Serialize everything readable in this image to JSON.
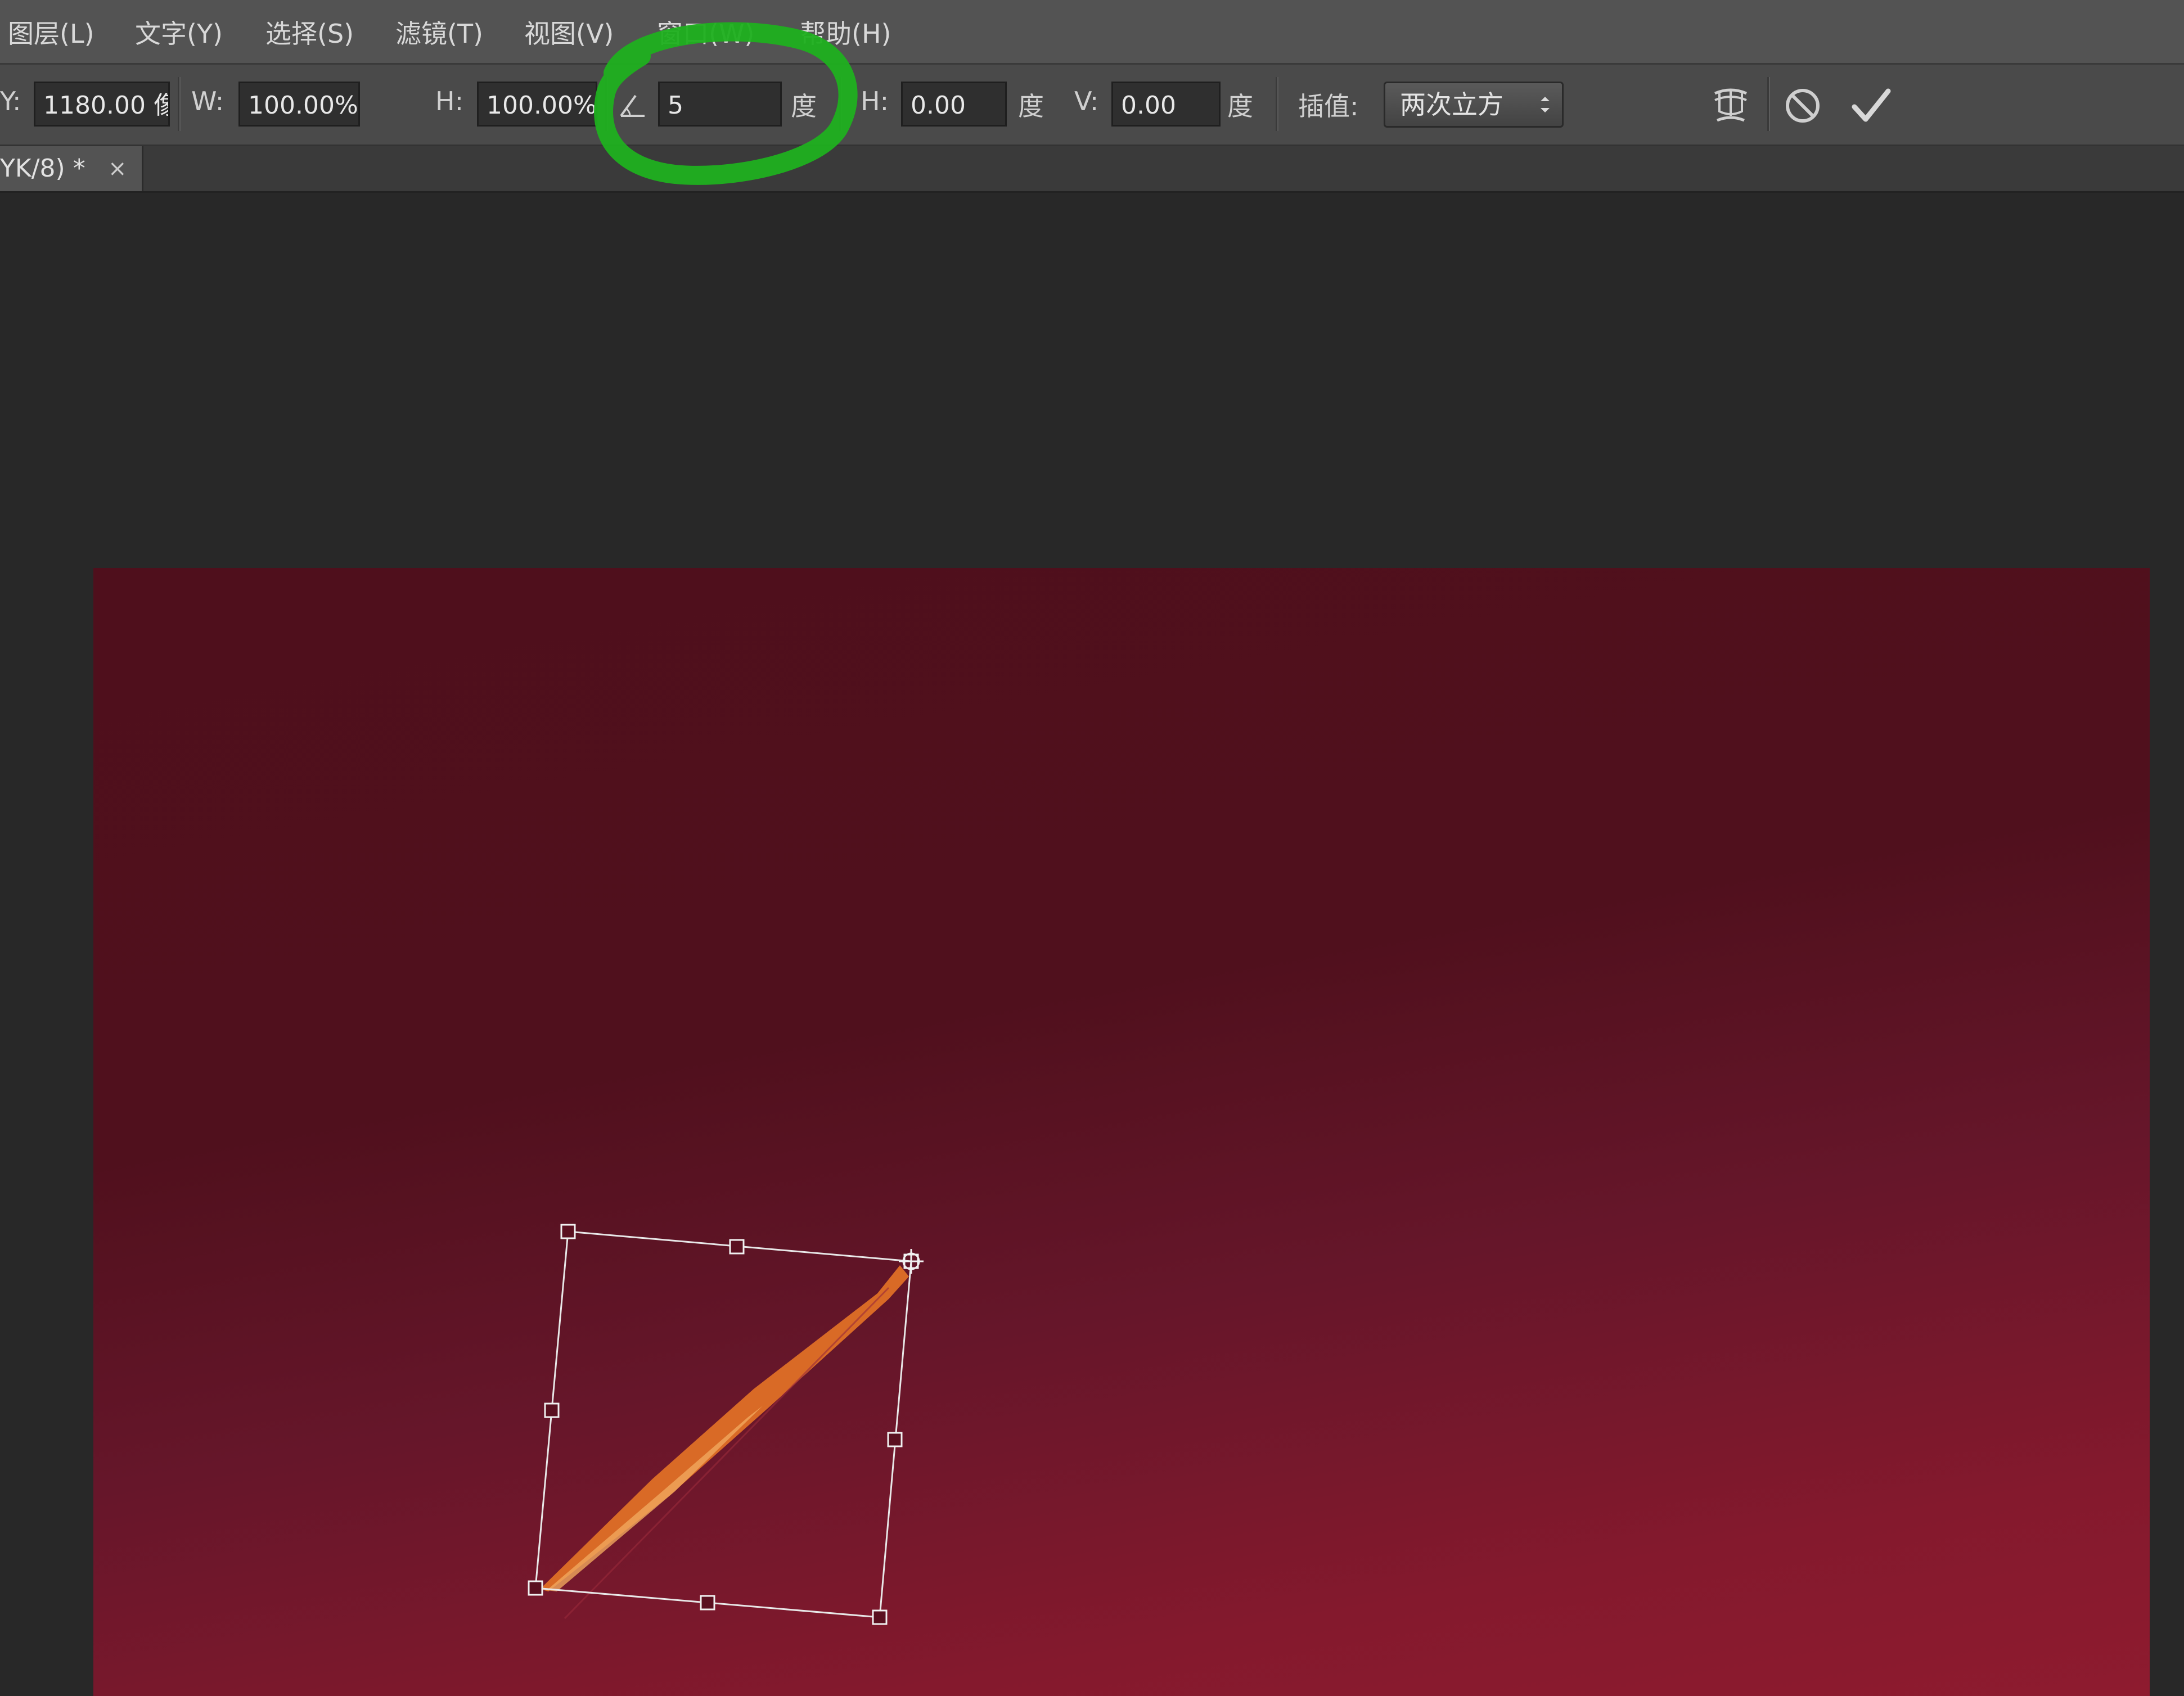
{
  "menu": {
    "items": [
      {
        "label": "图层(L)"
      },
      {
        "label": "文字(Y)"
      },
      {
        "label": "选择(S)"
      },
      {
        "label": "滤镜(T)"
      },
      {
        "label": "视图(V)"
      },
      {
        "label": "窗口(W)"
      },
      {
        "label": "帮助(H)"
      }
    ]
  },
  "options": {
    "y_label": "Y:",
    "y_value": "1180.00 像",
    "w_label": "W:",
    "w_value": "100.00%",
    "link_icon": "link-chain-icon",
    "h_label": "H:",
    "h_value": "100.00%",
    "angle_icon": "angle-icon",
    "angle_value": "5",
    "angle_unit": "度",
    "hskew_label": "H:",
    "hskew_value": "0.00",
    "hskew_unit": "度",
    "vskew_label": "V:",
    "vskew_value": "0.00",
    "vskew_unit": "度",
    "interp_label": "插值:",
    "interp_value": "两次立方",
    "warp_icon": "warp-mode-icon",
    "cancel_icon": "cancel-icon",
    "commit_icon": "commit-checkmark-icon"
  },
  "document": {
    "tab_title": "YK/8) *",
    "close_glyph": "×"
  },
  "annotation": {
    "highlight_color": "#1fb01f"
  },
  "colors": {
    "canvas_dark": "#4f0f1c",
    "canvas_light": "#8e1b2f",
    "brush_stroke": "#e07020"
  }
}
